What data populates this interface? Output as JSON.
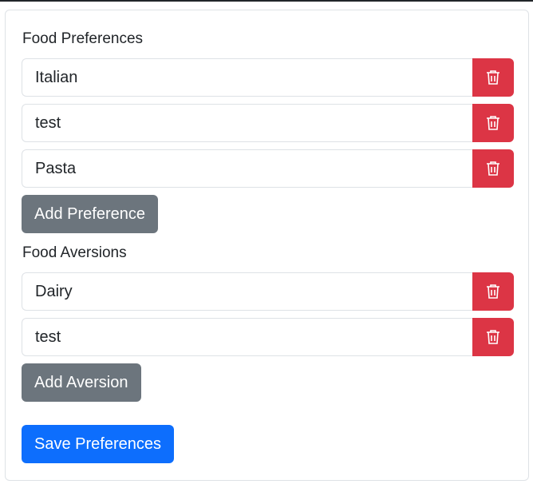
{
  "preferences": {
    "label": "Food Preferences",
    "items": [
      "Italian",
      "test",
      "Pasta"
    ],
    "add_label": "Add Preference"
  },
  "aversions": {
    "label": "Food Aversions",
    "items": [
      "Dairy",
      "test"
    ],
    "add_label": "Add Aversion"
  },
  "save_label": "Save Preferences",
  "colors": {
    "danger": "#dc3545",
    "secondary": "#6c757d",
    "primary": "#0d6efd",
    "border": "#dee2e6"
  },
  "icons": {
    "delete": "trash-icon"
  }
}
